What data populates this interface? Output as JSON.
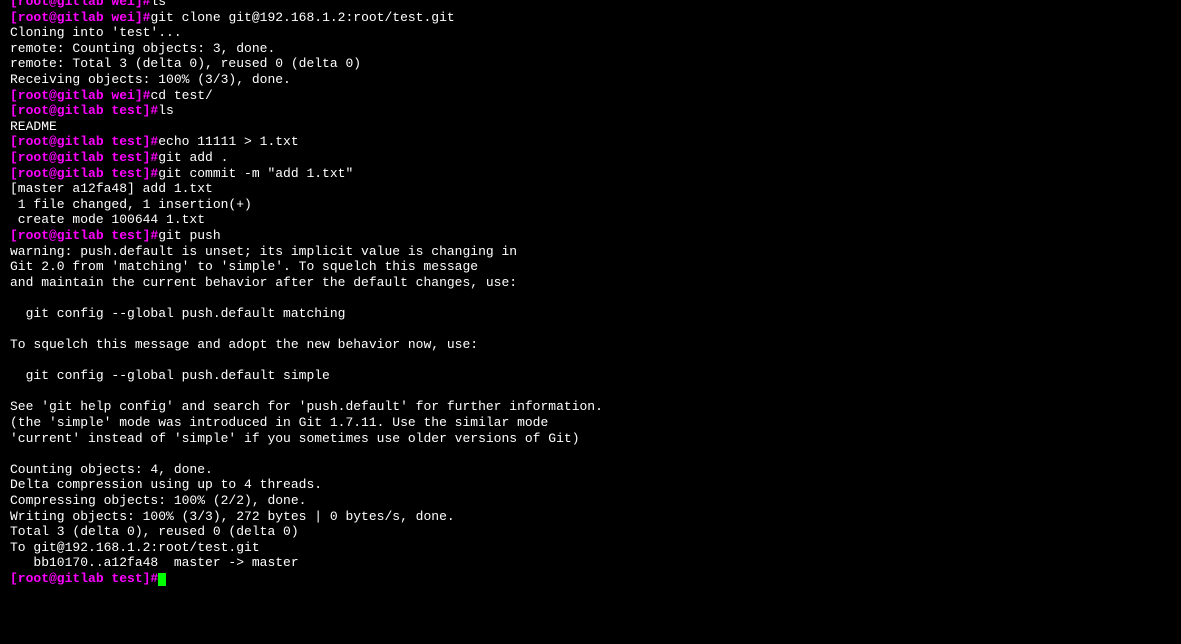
{
  "user": "root",
  "host": "gitlab",
  "dir1": "wei",
  "dir2": "test",
  "lines": [
    {
      "type": "prompt_partial",
      "dir": "wei",
      "prefix": "[root@gitlab wei]#",
      "cmd": "ls"
    },
    {
      "type": "prompt",
      "dir": "wei",
      "cmd": "git clone git@192.168.1.2:root/test.git"
    },
    {
      "type": "output",
      "text": "Cloning into 'test'..."
    },
    {
      "type": "output",
      "text": "remote: Counting objects: 3, done."
    },
    {
      "type": "output",
      "text": "remote: Total 3 (delta 0), reused 0 (delta 0)"
    },
    {
      "type": "output",
      "text": "Receiving objects: 100% (3/3), done."
    },
    {
      "type": "prompt",
      "dir": "wei",
      "cmd": "cd test/"
    },
    {
      "type": "prompt",
      "dir": "test",
      "cmd": "ls"
    },
    {
      "type": "output",
      "text": "README"
    },
    {
      "type": "prompt",
      "dir": "test",
      "cmd": "echo 11111 > 1.txt"
    },
    {
      "type": "prompt",
      "dir": "test",
      "cmd": "git add ."
    },
    {
      "type": "prompt",
      "dir": "test",
      "cmd": "git commit -m \"add 1.txt\""
    },
    {
      "type": "output",
      "text": "[master a12fa48] add 1.txt"
    },
    {
      "type": "output",
      "text": " 1 file changed, 1 insertion(+)"
    },
    {
      "type": "output",
      "text": " create mode 100644 1.txt"
    },
    {
      "type": "prompt",
      "dir": "test",
      "cmd": "git push"
    },
    {
      "type": "output",
      "text": "warning: push.default is unset; its implicit value is changing in"
    },
    {
      "type": "output",
      "text": "Git 2.0 from 'matching' to 'simple'. To squelch this message"
    },
    {
      "type": "output",
      "text": "and maintain the current behavior after the default changes, use:"
    },
    {
      "type": "output",
      "text": ""
    },
    {
      "type": "output",
      "text": "  git config --global push.default matching"
    },
    {
      "type": "output",
      "text": ""
    },
    {
      "type": "output",
      "text": "To squelch this message and adopt the new behavior now, use:"
    },
    {
      "type": "output",
      "text": ""
    },
    {
      "type": "output",
      "text": "  git config --global push.default simple"
    },
    {
      "type": "output",
      "text": ""
    },
    {
      "type": "output",
      "text": "See 'git help config' and search for 'push.default' for further information."
    },
    {
      "type": "output",
      "text": "(the 'simple' mode was introduced in Git 1.7.11. Use the similar mode"
    },
    {
      "type": "output",
      "text": "'current' instead of 'simple' if you sometimes use older versions of Git)"
    },
    {
      "type": "output",
      "text": ""
    },
    {
      "type": "output",
      "text": "Counting objects: 4, done."
    },
    {
      "type": "output",
      "text": "Delta compression using up to 4 threads."
    },
    {
      "type": "output",
      "text": "Compressing objects: 100% (2/2), done."
    },
    {
      "type": "output",
      "text": "Writing objects: 100% (3/3), 272 bytes | 0 bytes/s, done."
    },
    {
      "type": "output",
      "text": "Total 3 (delta 0), reused 0 (delta 0)"
    },
    {
      "type": "output",
      "text": "To git@192.168.1.2:root/test.git"
    },
    {
      "type": "output",
      "text": "   bb10170..a12fa48  master -> master"
    },
    {
      "type": "prompt_cursor",
      "dir": "test",
      "cmd": ""
    }
  ]
}
